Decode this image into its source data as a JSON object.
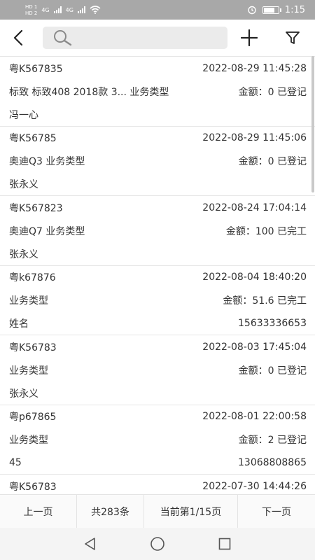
{
  "status": {
    "time": "1:15",
    "sim1": "HD 1",
    "sim2": "HD 2",
    "net1": "4G",
    "net2": "4G",
    "battery_level": 0.8
  },
  "toolbar": {
    "back_icon": "back-arrow-icon",
    "search_placeholder": "",
    "search_value": "",
    "add_icon": "plus-icon",
    "filter_icon": "filter-icon"
  },
  "records": [
    {
      "plate": "粤K567835",
      "time": "2022-08-29 11:45:28",
      "desc": "标致 标致408 2018款 3... 业务类型",
      "status": "金额：0 已登记",
      "name": "冯一心",
      "phone": ""
    },
    {
      "plate": "粤K56785",
      "time": "2022-08-29 11:45:06",
      "desc": "奥迪Q3 业务类型",
      "status": "金额：0 已登记",
      "name": "张永义",
      "phone": ""
    },
    {
      "plate": "粤K567823",
      "time": "2022-08-24 17:04:14",
      "desc": "奥迪Q7 业务类型",
      "status": "金额：100 已完工",
      "name": "张永义",
      "phone": ""
    },
    {
      "plate": "粤k67876",
      "time": "2022-08-04 18:40:20",
      "desc": "业务类型",
      "status": "金额：51.6 已完工",
      "name": "姓名",
      "phone": "15633336653"
    },
    {
      "plate": "粤K56783",
      "time": "2022-08-03 17:45:04",
      "desc": "业务类型",
      "status": "金额：0 已登记",
      "name": "张永义",
      "phone": ""
    },
    {
      "plate": "粤p67865",
      "time": "2022-08-01 22:00:58",
      "desc": "业务类型",
      "status": "金额：2 已登记",
      "name": "45",
      "phone": "13068808865"
    },
    {
      "plate": "粤K56783",
      "time": "2022-07-30 14:44:26",
      "desc": "",
      "status": "",
      "name": "",
      "phone": ""
    }
  ],
  "pager": {
    "prev": "上一页",
    "total": "共283条",
    "current": "当前第1/15页",
    "next": "下一页"
  },
  "navbar": {
    "back": "triangle-back-icon",
    "home": "circle-home-icon",
    "recent": "square-recent-icon"
  }
}
